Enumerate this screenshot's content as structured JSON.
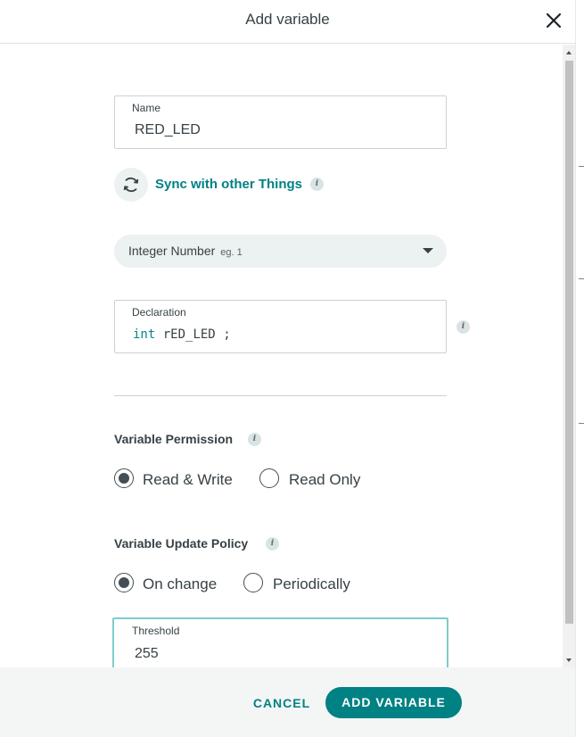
{
  "dialog": {
    "title": "Add variable"
  },
  "name_field": {
    "label": "Name",
    "value": "RED_LED"
  },
  "sync": {
    "label": "Sync with other Things"
  },
  "type_select": {
    "value": "Integer Number",
    "hint": "eg. 1"
  },
  "declaration": {
    "label": "Declaration",
    "keyword": "int",
    "identifier": "rED_LED",
    "terminator": ";"
  },
  "permission": {
    "title": "Variable Permission",
    "options": [
      {
        "label": "Read & Write",
        "checked": true
      },
      {
        "label": "Read Only",
        "checked": false
      }
    ]
  },
  "update_policy": {
    "title": "Variable Update Policy",
    "options": [
      {
        "label": "On change",
        "checked": true
      },
      {
        "label": "Periodically",
        "checked": false
      }
    ]
  },
  "threshold": {
    "label": "Threshold",
    "value": "255"
  },
  "footer": {
    "cancel_label": "CANCEL",
    "add_label": "ADD VARIABLE"
  },
  "colors": {
    "accent": "#008184",
    "focus_border": "#7ecccb",
    "radio": "#434f54"
  }
}
